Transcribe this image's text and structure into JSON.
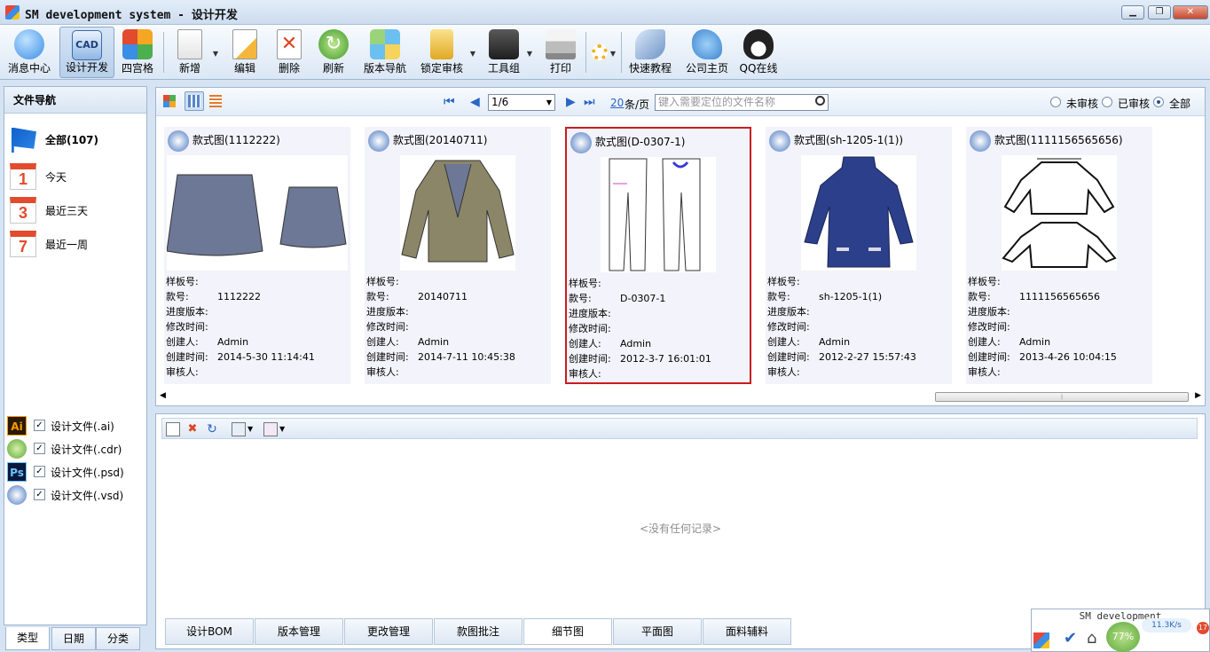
{
  "window": {
    "title": "SM development system - 设计开发",
    "minimize": "▁",
    "maximize": "❐",
    "close": "✕"
  },
  "toolbar": {
    "buttons": [
      {
        "label": "消息中心",
        "icon": "message-bubble-icon"
      },
      {
        "label": "设计开发",
        "icon": "cad-icon",
        "active": true
      },
      {
        "label": "四宫格",
        "icon": "grid-icon"
      },
      {
        "label": "新增",
        "icon": "new-document-icon"
      },
      {
        "label": "编辑",
        "icon": "edit-icon"
      },
      {
        "label": "删除",
        "icon": "delete-icon"
      },
      {
        "label": "刷新",
        "icon": "refresh-icon"
      },
      {
        "label": "版本导航",
        "icon": "version-icon"
      },
      {
        "label": "锁定审核",
        "icon": "lock-icon"
      },
      {
        "label": "工具组",
        "icon": "tools-icon"
      },
      {
        "label": "打印",
        "icon": "printer-icon"
      },
      {
        "label": "快速教程",
        "icon": "tutorial-icon"
      },
      {
        "label": "公司主页",
        "icon": "thumbs-up-icon"
      },
      {
        "label": "QQ在线",
        "icon": "qq-icon"
      }
    ]
  },
  "leftnav": {
    "title": "文件导航",
    "items": [
      {
        "label": "全部(107)",
        "badge": ""
      },
      {
        "label": "今天",
        "badge": "1"
      },
      {
        "label": "最近三天",
        "badge": "3"
      },
      {
        "label": "最近一周",
        "badge": "7"
      }
    ],
    "filetypes": [
      {
        "icon_text": "Ai",
        "label": "设计文件(.ai)",
        "checked": "✓"
      },
      {
        "icon_text": "",
        "label": "设计文件(.cdr)",
        "checked": "✓"
      },
      {
        "icon_text": "Ps",
        "label": "设计文件(.psd)",
        "checked": "✓"
      },
      {
        "icon_text": "",
        "label": "设计文件(.vsd)",
        "checked": "✓"
      }
    ],
    "bottom_tabs": [
      "类型",
      "日期",
      "分类"
    ]
  },
  "viewbar": {
    "page": "1/6",
    "page_size": "20",
    "page_unit": "条/页",
    "search_placeholder": "键入需要定位的文件名称",
    "filters": [
      "未审核",
      "已审核",
      "全部"
    ]
  },
  "card_labels": {
    "sample": "样板号:",
    "style": "款号:",
    "progress": "进度版本:",
    "modified": "修改时间:",
    "creator": "创建人:",
    "created": "创建时间:",
    "reviewer": "审核人:"
  },
  "cards": [
    {
      "title": "款式图(1112222)",
      "style": "1112222",
      "creator": "Admin",
      "created": "2014-5-30 11:14:41"
    },
    {
      "title": "款式图(20140711)",
      "style": "20140711",
      "creator": "Admin",
      "created": "2014-7-11 10:45:38"
    },
    {
      "title": "款式图(D-0307-1)",
      "style": "D-0307-1",
      "creator": "Admin",
      "created": "2012-3-7 16:01:01"
    },
    {
      "title": "款式图(sh-1205-1(1))",
      "style": "sh-1205-1(1)",
      "creator": "Admin",
      "created": "2012-2-27 15:57:43"
    },
    {
      "title": "款式图(1111156565656)",
      "style": "1111156565656",
      "creator": "Admin",
      "created": "2013-4-26 10:04:15"
    }
  ],
  "detail": {
    "empty_text": "<没有任何记录>",
    "tabs": [
      "设计BOM",
      "版本管理",
      "更改管理",
      "款图批注",
      "细节图",
      "平面图",
      "面料辅料"
    ]
  },
  "widget": {
    "title": "SM development",
    "gauge": "77%",
    "speed": "11.3K/s",
    "badge": "17"
  },
  "colors": {
    "selected_border": "#c91d1d",
    "accent": "#2a66c4",
    "panel_border": "#9fb6d3"
  }
}
